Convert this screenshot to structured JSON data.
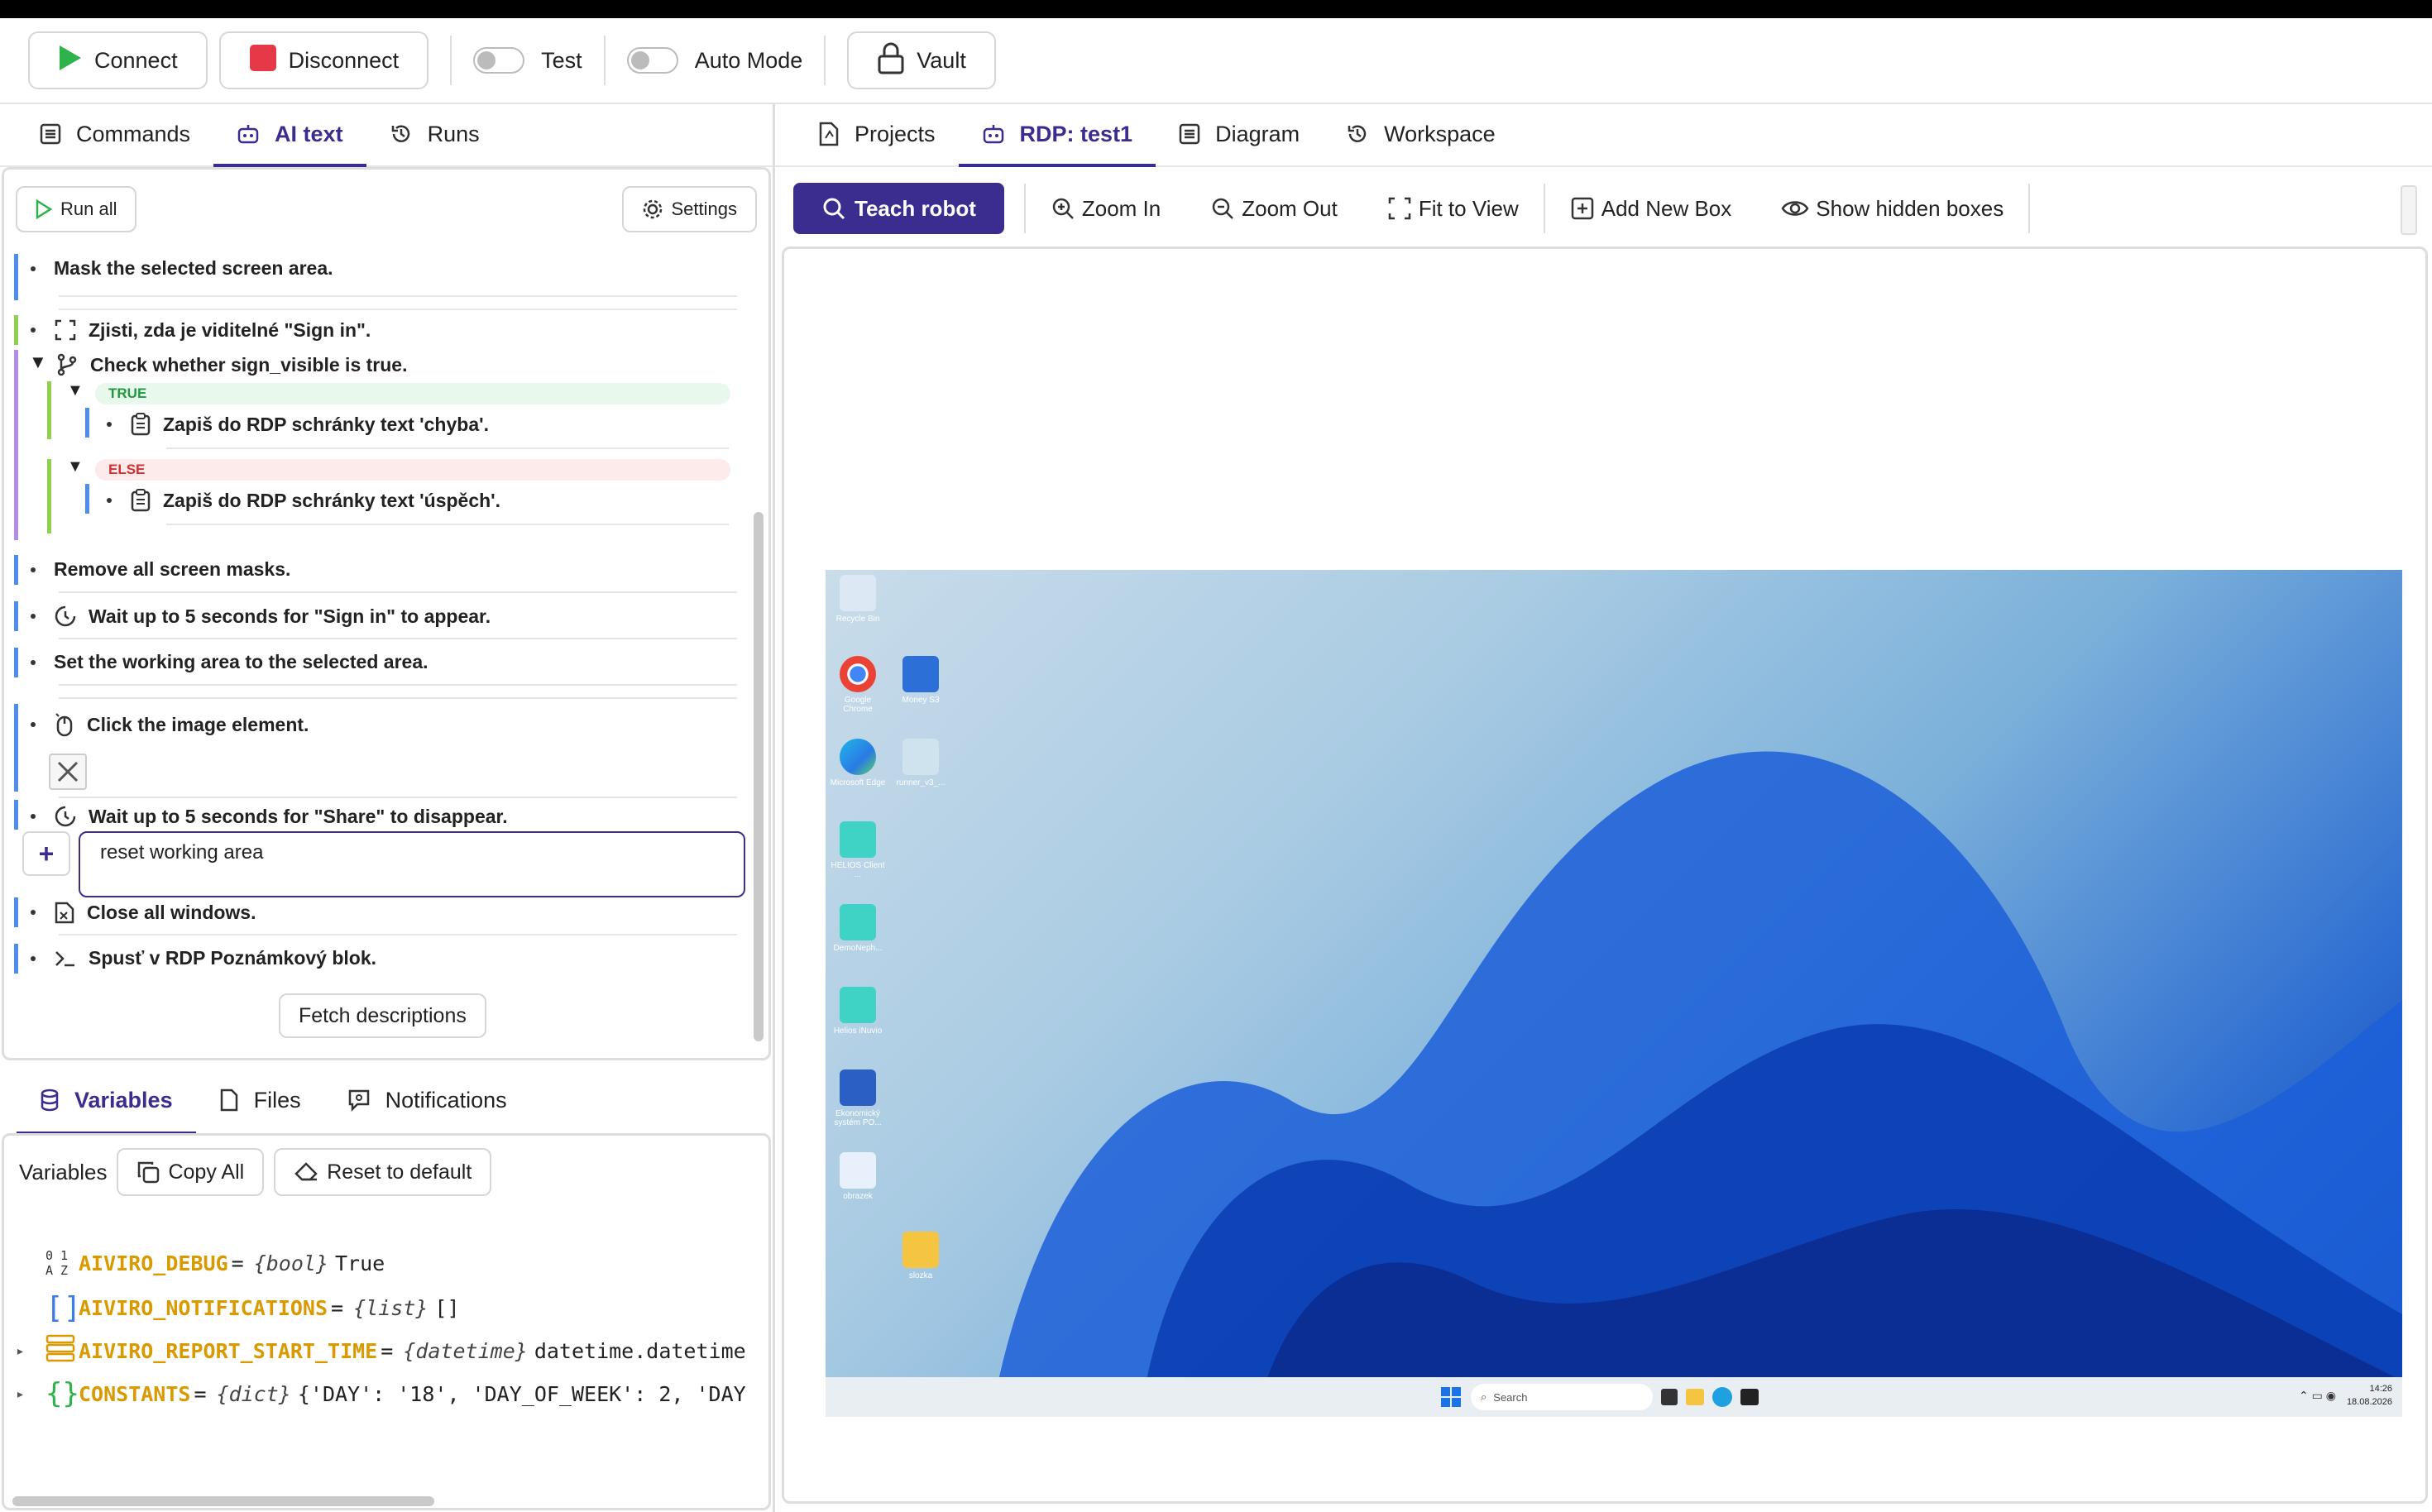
{
  "toolbar": {
    "connect": "Connect",
    "disconnect": "Disconnect",
    "test": "Test",
    "auto_mode": "Auto Mode",
    "vault": "Vault"
  },
  "left_tabs": [
    "Commands",
    "AI text",
    "Runs"
  ],
  "cmd": {
    "run_all": "Run all",
    "settings": "Settings",
    "fetch": "Fetch descriptions",
    "input_value": "reset working area"
  },
  "steps": {
    "s1": "Mask the selected screen area.",
    "s2": "Zjisti, zda je viditelné \"Sign in\".",
    "s3": "Check whether sign_visible is true.",
    "true_label": "TRUE",
    "s4": "Zapiš do RDP schránky text 'chyba'.",
    "else_label": "ELSE",
    "s5": "Zapiš do RDP schránky text 'úspěch'.",
    "s6": "Remove all screen masks.",
    "s7": "Wait up to 5 seconds for \"Sign in\" to appear.",
    "s8": "Set the working area to the selected area.",
    "s9": "Click the image element.",
    "s10": "Wait up to 5 seconds for \"Share\" to disappear.",
    "s11": "Close all windows.",
    "s12": "Spusť v RDP Poznámkový blok."
  },
  "bottom_tabs": [
    "Variables",
    "Files",
    "Notifications"
  ],
  "vars": {
    "label": "Variables",
    "copy_all": "Copy All",
    "reset": "Reset to default",
    "rows": [
      {
        "icon": "0 1 A Z",
        "name": "AIVIRO_DEBUG",
        "type": "{bool}",
        "value": "True"
      },
      {
        "icon": "[ ]",
        "name": "AIVIRO_NOTIFICATIONS",
        "type": "{list}",
        "value": "[]"
      },
      {
        "icon": "",
        "name": "AIVIRO_REPORT_START_TIME",
        "type": "{datetime}",
        "value": "datetime.datetime"
      },
      {
        "icon": "{ }",
        "name": "CONSTANTS",
        "type": "{dict}",
        "value": "{'DAY': '18', 'DAY_OF_WEEK': 2, 'DAY"
      }
    ]
  },
  "right_tabs": [
    "Projects",
    "RDP: test1",
    "Diagram",
    "Workspace"
  ],
  "rdp_tools": {
    "teach": "Teach robot",
    "zoom_in": "Zoom In",
    "zoom_out": "Zoom Out",
    "fit": "Fit to View",
    "add_box": "Add New Box",
    "show_hidden": "Show hidden boxes"
  },
  "desktop": {
    "icons": [
      "Recycle Bin",
      "Google Chrome",
      "Money S3",
      "Microsoft Edge",
      "runner_v3_...",
      "HELIOS Client ...",
      "DemoNeph...",
      "Helios iNuvio",
      "Ekonomický systém PO...",
      "obrazek",
      "slozka"
    ],
    "search": "Search",
    "time": "14:26",
    "date": "18.08.2026"
  },
  "colors": {
    "accent": "#3b2c8f",
    "connect": "#2db34a",
    "disconnect": "#e53947"
  }
}
